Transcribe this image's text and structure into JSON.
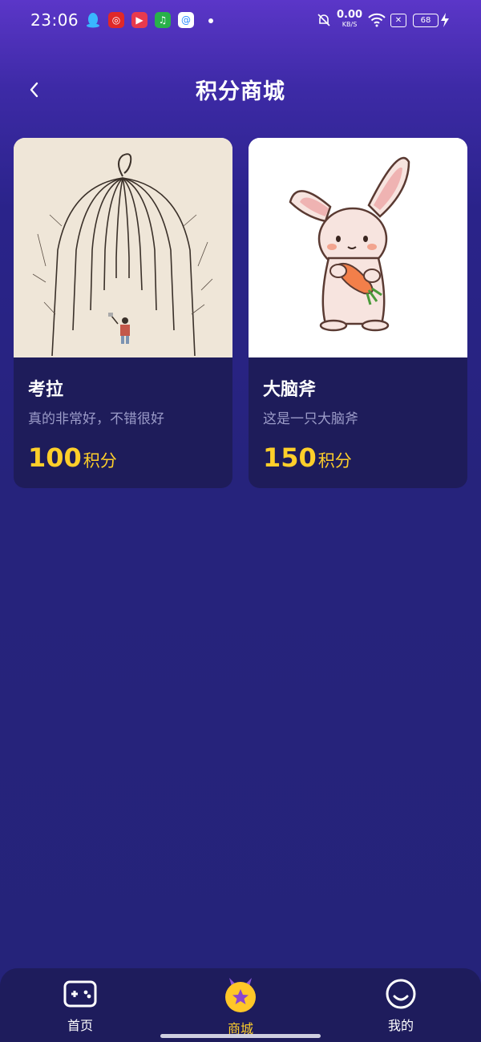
{
  "status_bar": {
    "time": "23:06",
    "speed_value": "0.00",
    "speed_unit": "KB/S",
    "battery": "68"
  },
  "header": {
    "title": "积分商城"
  },
  "products": [
    {
      "name": "考拉",
      "desc": "真的非常好，不错很好",
      "price": "100",
      "unit": "积分"
    },
    {
      "name": "大脑斧",
      "desc": "这是一只大脑斧",
      "price": "150",
      "unit": "积分"
    }
  ],
  "nav": {
    "items": [
      {
        "label": "首页",
        "icon": "gamepad-icon"
      },
      {
        "label": "商城",
        "icon": "star-medal-icon",
        "active": true
      },
      {
        "label": "我的",
        "icon": "smile-icon"
      }
    ]
  },
  "colors": {
    "accent": "#ffcf2a",
    "card_bg": "#1e1c5a"
  }
}
